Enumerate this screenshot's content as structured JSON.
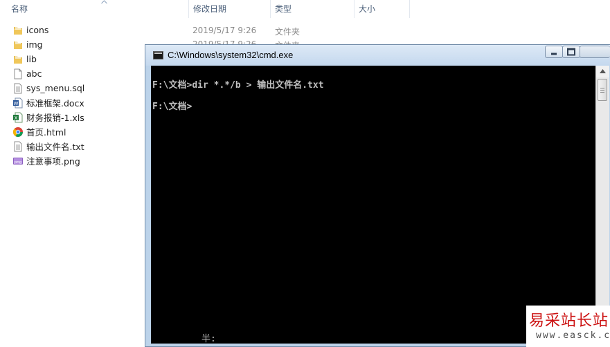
{
  "explorer": {
    "columns": {
      "name": "名称",
      "modified": "修改日期",
      "type": "类型",
      "size": "大小"
    },
    "files": [
      {
        "name": "icons",
        "icon": "folder-icon",
        "modified": "2019/5/17 9:26",
        "type": "文件夹"
      },
      {
        "name": "img",
        "icon": "folder-icon",
        "modified": "2019/5/17 9:26",
        "type": "文件夹"
      },
      {
        "name": "lib",
        "icon": "folder-icon"
      },
      {
        "name": "abc",
        "icon": "blank-file-icon"
      },
      {
        "name": "sys_menu.sql",
        "icon": "text-file-icon"
      },
      {
        "name": "标准框架.docx",
        "icon": "word-doc-icon"
      },
      {
        "name": "财务报销-1.xls",
        "icon": "excel-file-icon"
      },
      {
        "name": "首页.html",
        "icon": "chrome-html-icon"
      },
      {
        "name": "输出文件名.txt",
        "icon": "text-file-icon"
      },
      {
        "name": "注意事项.png",
        "icon": "png-image-icon"
      }
    ]
  },
  "cmd": {
    "title": "C:\\Windows\\system32\\cmd.exe",
    "lines": [
      {
        "prompt": "F:\\文档>",
        "command": "dir *.*/b > 输出文件名.txt"
      },
      {
        "prompt": "F:\\文档>",
        "command": ""
      }
    ],
    "ime_status": "半:"
  },
  "watermark": {
    "text": "易采站长站",
    "url": "www.easck.com"
  }
}
